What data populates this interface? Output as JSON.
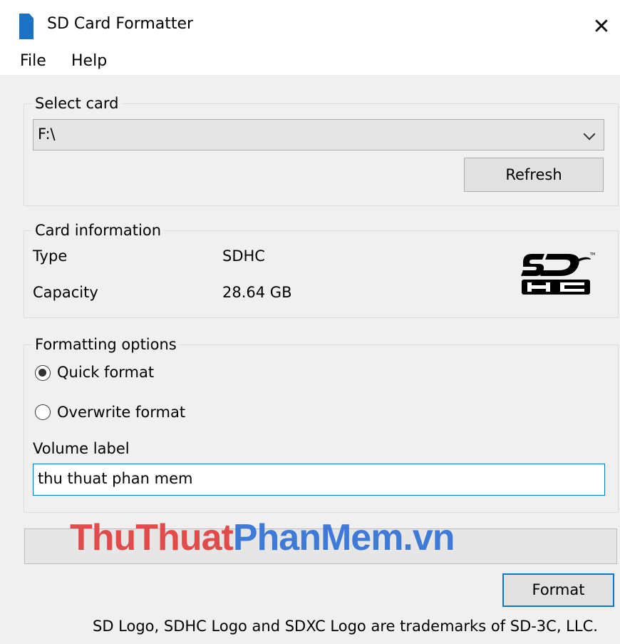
{
  "window": {
    "title": "SD Card Formatter",
    "close_glyph": "✕"
  },
  "menu": {
    "file": "File",
    "help": "Help"
  },
  "select_card": {
    "legend": "Select card",
    "selected_drive": "F:\\",
    "refresh_label": "Refresh"
  },
  "card_information": {
    "legend": "Card information",
    "type_label": "Type",
    "type_value": "SDHC",
    "capacity_label": "Capacity",
    "capacity_value": "28.64 GB",
    "logo": "sdhc-logo",
    "logo_tm": "TM"
  },
  "formatting_options": {
    "legend": "Formatting options",
    "quick_format": "Quick format",
    "overwrite_format": "Overwrite format",
    "selected": "quick",
    "volume_label_caption": "Volume label",
    "volume_label_value": "thu thuat phan mem"
  },
  "progress": {
    "value": 0
  },
  "watermark": {
    "part1": "ThuThuat",
    "part2": "PhanMem.vn"
  },
  "actions": {
    "format_label": "Format"
  },
  "footer": {
    "trademark_text": "SD Logo, SDHC Logo and SDXC Logo are trademarks of SD-3C, LLC."
  },
  "colors": {
    "accent": "#0078d7",
    "app_icon": "#1a73c9",
    "watermark_red": "#e23b3b",
    "watermark_blue": "#2d6fd6"
  }
}
